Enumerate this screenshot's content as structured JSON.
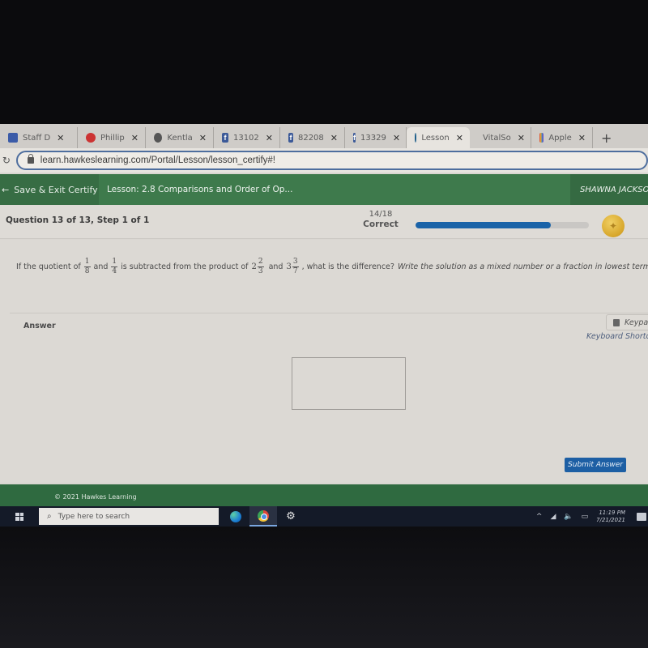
{
  "browser": {
    "tabs": [
      {
        "label": "Staff D",
        "icon": "staff-icon",
        "color": "#3b5ba8",
        "active": false
      },
      {
        "label": "Phillip",
        "icon": "generic-site-icon",
        "color": "#c33",
        "active": false
      },
      {
        "label": "Kentla",
        "icon": "globe-icon",
        "color": "#555",
        "active": false
      },
      {
        "label": "13102",
        "icon": "facebook-icon",
        "color": "#3b5998",
        "active": false
      },
      {
        "label": "82208",
        "icon": "facebook-icon",
        "color": "#3b5998",
        "active": false
      },
      {
        "label": "13329",
        "icon": "facebook-icon",
        "color": "#3b5998",
        "active": false
      },
      {
        "label": "Lesson",
        "icon": "hawkes-icon",
        "color": "#1f5f8b",
        "active": true
      },
      {
        "label": "VitalSo",
        "icon": "vitalsource-icon",
        "color": "#e5762a",
        "active": false
      },
      {
        "label": "Apple",
        "icon": "apple-bag-icon",
        "color": "#b52f6a",
        "active": false
      }
    ],
    "new_tab_label": "+",
    "close_glyph": "✕",
    "url": "learn.hawkeslearning.com/Portal/Lesson/lesson_certify#!"
  },
  "header": {
    "save_exit_label": "Save & Exit Certify",
    "lesson_title": "Lesson: 2.8 Comparisons and Order of Op...",
    "user_name": "SHAWNA JACKSON"
  },
  "question_bar": {
    "label": "Question 13 of 13, Step 1 of 1",
    "score_fraction": "14/18",
    "score_label": "Correct",
    "progress_percent": 78
  },
  "question": {
    "part1": "If the quotient of",
    "frac1": {
      "num": "1",
      "den": "8"
    },
    "and1": "and",
    "frac2": {
      "num": "1",
      "den": "4"
    },
    "part2": "is subtracted from the product of",
    "mixed1": {
      "whole": "2",
      "num": "2",
      "den": "3"
    },
    "and2": "and",
    "mixed2": {
      "whole": "3",
      "num": "3",
      "den": "7"
    },
    "part3": ", what is the difference?",
    "instruction": "Write the solution as a mixed number or a fraction in lowest terms."
  },
  "answer": {
    "label": "Answer",
    "keypad_label": "Keypad",
    "keyboard_shortcuts_label": "Keyboard Shortcuts",
    "value": "",
    "submit_label": "Submit Answer"
  },
  "footer": {
    "copyright": "© 2021 Hawkes Learning"
  },
  "taskbar": {
    "search_placeholder": "Type here to search",
    "time": "11:19 PM",
    "date": "7/21/2021"
  },
  "colors": {
    "header_green": "#3e7a4c",
    "progress_blue": "#1a63a8",
    "submit_blue": "#1d5fa4"
  }
}
